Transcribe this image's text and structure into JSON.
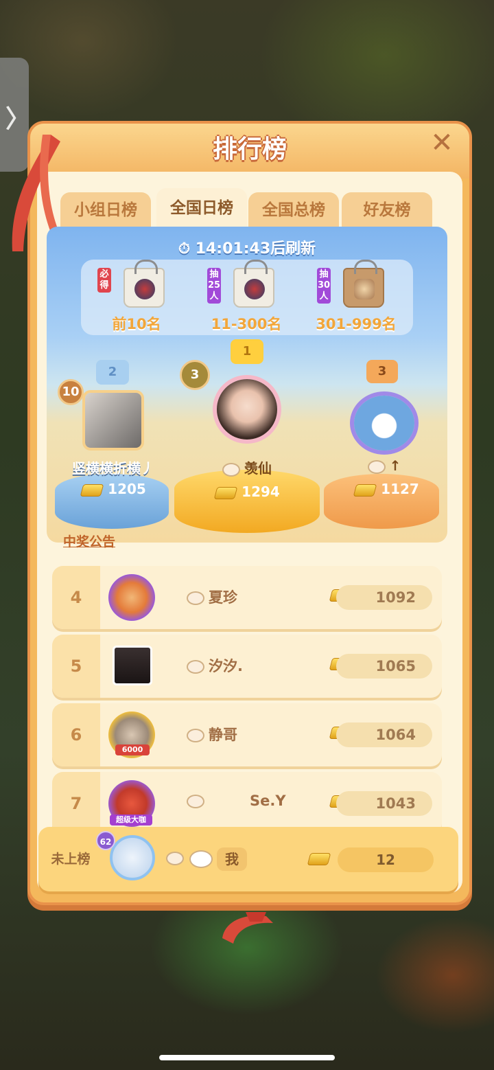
{
  "panel": {
    "title": "排行榜"
  },
  "tabs": [
    {
      "label": "小组日榜",
      "active": false
    },
    {
      "label": "全国日榜",
      "active": true
    },
    {
      "label": "全国总榜",
      "active": false
    },
    {
      "label": "好友榜",
      "active": false
    }
  ],
  "hero": {
    "refresh_text": "14:01:43后刷新",
    "prizes": [
      {
        "tag": "必得",
        "label": "前10名"
      },
      {
        "tag": "抽25人",
        "label": "11-300名"
      },
      {
        "tag": "抽30人",
        "label": "301-999名"
      }
    ]
  },
  "podium": {
    "first": {
      "crown": "1",
      "medal": "3",
      "name": "羡仙",
      "score": "1294"
    },
    "second": {
      "crown": "2",
      "medal": "10",
      "name": "竖横横折横丿",
      "score": "1205"
    },
    "third": {
      "crown": "3",
      "name": "↑",
      "score": "1127"
    }
  },
  "notice_link": "中奖公告",
  "rows": [
    {
      "rank": "4",
      "name": "夏珍",
      "score": "1092"
    },
    {
      "rank": "5",
      "name": "汐汐.",
      "score": "1065"
    },
    {
      "rank": "6",
      "name": "静哥",
      "score": "1064"
    },
    {
      "rank": "7",
      "name": "Se.Y",
      "score": "1043"
    }
  ],
  "row6_badge": "6000",
  "row7_badge": "超级大咖",
  "me": {
    "rank_label": "未上榜",
    "level": "62",
    "name": "我",
    "score": "12"
  },
  "colors": {
    "panel": "#f4b85c",
    "accent": "#e9924a",
    "gold": "#e0a21b"
  }
}
